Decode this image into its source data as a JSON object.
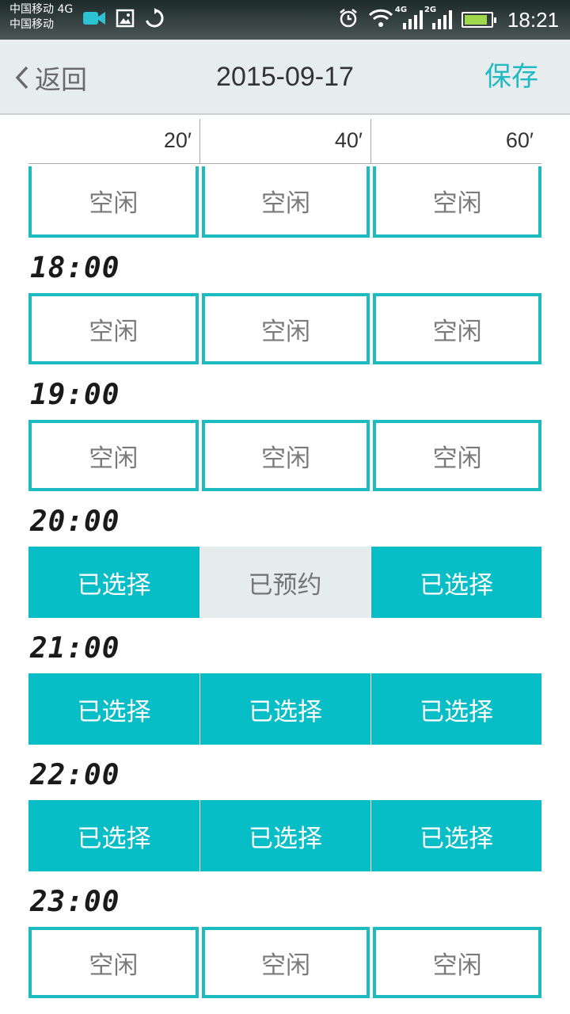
{
  "status_bar": {
    "carrier1": "中国移动 4G",
    "carrier2": "中国移动",
    "net1": "4G",
    "net2": "2G",
    "time": "18:21",
    "icons": [
      "video-icon",
      "image-icon",
      "sync-icon",
      "alarm-icon",
      "wifi-icon",
      "signal-icon",
      "signal-icon",
      "battery-icon"
    ],
    "battery_level": 0.7
  },
  "nav": {
    "back_label": "返回",
    "title": "2015-09-17",
    "save_label": "保存"
  },
  "scale": [
    "20′",
    "40′",
    "60′"
  ],
  "schedule": [
    {
      "time": "",
      "slots": [
        "空闲",
        "空闲",
        "空闲"
      ]
    },
    {
      "time": "18:00",
      "slots": [
        "空闲",
        "空闲",
        "空闲"
      ]
    },
    {
      "time": "19:00",
      "slots": [
        "空闲",
        "空闲",
        "空闲"
      ]
    },
    {
      "time": "20:00",
      "slots": [
        "已选择",
        "已预约",
        "已选择"
      ]
    },
    {
      "time": "21:00",
      "slots": [
        "已选择",
        "已选择",
        "已选择"
      ]
    },
    {
      "time": "22:00",
      "slots": [
        "已选择",
        "已选择",
        "已选择"
      ]
    },
    {
      "time": "23:00",
      "slots": [
        "空闲",
        "空闲",
        "空闲"
      ]
    }
  ],
  "colors": {
    "accent": "#08bec6",
    "free_border": "#1cbbbf",
    "booked_bg": "#e6ecec"
  }
}
